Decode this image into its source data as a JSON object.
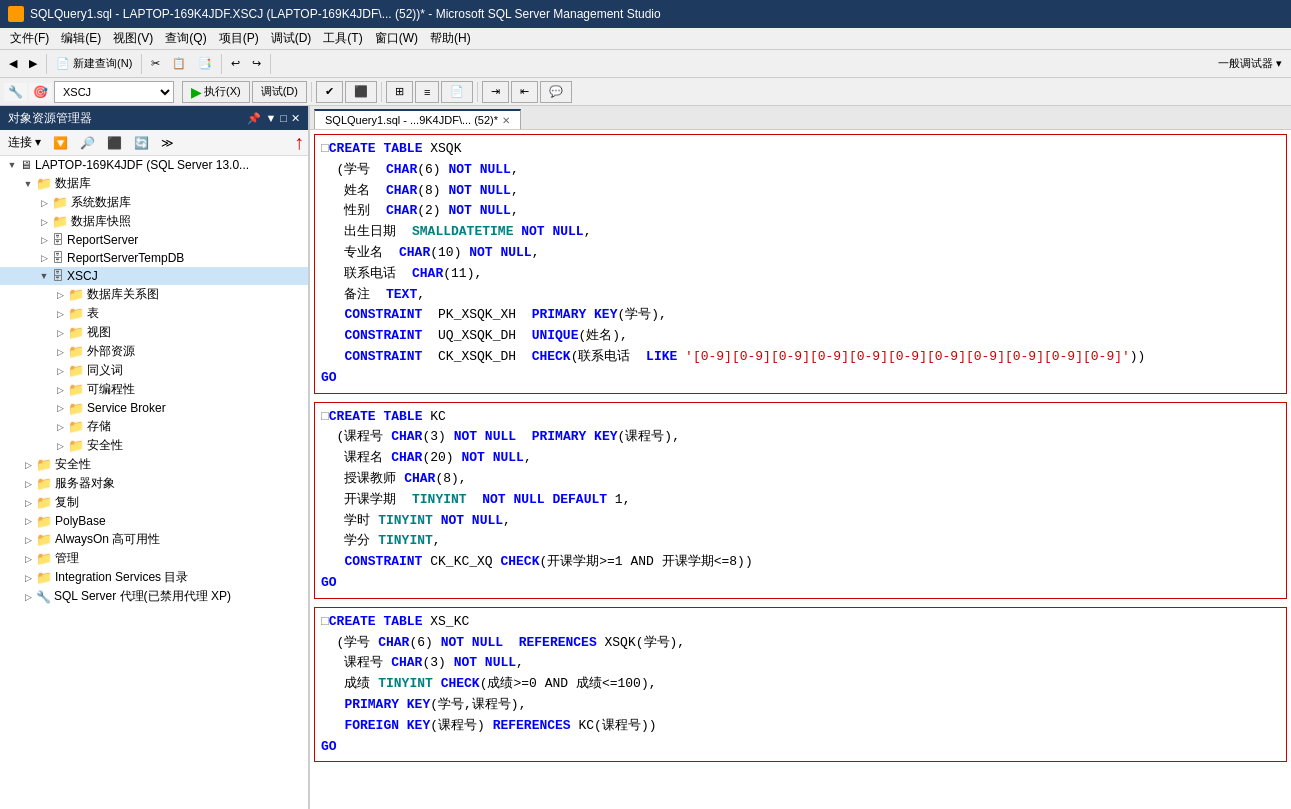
{
  "titleBar": {
    "title": "SQLQuery1.sql - LAPTOP-169K4JDF.XSCJ (LAPTOP-169K4JDF\\... (52))* - Microsoft SQL Server Management Studio"
  },
  "menuBar": {
    "items": [
      "文件(F)",
      "编辑(E)",
      "视图(V)",
      "查询(Q)",
      "项目(P)",
      "调试(D)",
      "工具(T)",
      "窗口(W)",
      "帮助(H)"
    ]
  },
  "toolbar2": {
    "dbSelector": "XSCJ",
    "executeBtn": "执行(X)",
    "debugBtn": "调试(D)"
  },
  "objectExplorer": {
    "title": "对象资源管理器",
    "connectBtn": "连接",
    "server": "LAPTOP-169K4JDF (SQL Server 13.0...",
    "nodes": [
      {
        "label": "数据库",
        "level": 1,
        "expanded": true
      },
      {
        "label": "系统数据库",
        "level": 2,
        "expanded": false
      },
      {
        "label": "数据库快照",
        "level": 2,
        "expanded": false
      },
      {
        "label": "ReportServer",
        "level": 2,
        "expanded": false
      },
      {
        "label": "ReportServerTempDB",
        "level": 2,
        "expanded": false
      },
      {
        "label": "XSCJ",
        "level": 2,
        "expanded": true
      },
      {
        "label": "数据库关系图",
        "level": 3,
        "expanded": false
      },
      {
        "label": "表",
        "level": 3,
        "expanded": false
      },
      {
        "label": "视图",
        "level": 3,
        "expanded": false
      },
      {
        "label": "外部资源",
        "level": 3,
        "expanded": false
      },
      {
        "label": "同义词",
        "level": 3,
        "expanded": false
      },
      {
        "label": "可编程性",
        "level": 3,
        "expanded": false
      },
      {
        "label": "Service Broker",
        "level": 3,
        "expanded": false
      },
      {
        "label": "存储",
        "level": 3,
        "expanded": false
      },
      {
        "label": "安全性",
        "level": 3,
        "expanded": false
      },
      {
        "label": "安全性",
        "level": 1,
        "expanded": false
      },
      {
        "label": "服务器对象",
        "level": 1,
        "expanded": false
      },
      {
        "label": "复制",
        "level": 1,
        "expanded": false
      },
      {
        "label": "PolyBase",
        "level": 1,
        "expanded": false
      },
      {
        "label": "AlwaysOn 高可用性",
        "level": 1,
        "expanded": false
      },
      {
        "label": "管理",
        "level": 1,
        "expanded": false
      },
      {
        "label": "Integration Services 目录",
        "level": 1,
        "expanded": false
      },
      {
        "label": "SQL Server 代理(已禁用代理 XP)",
        "level": 1,
        "expanded": false
      }
    ]
  },
  "tabs": [
    {
      "label": "SQLQuery1.sql - ...9K4JDF\\... (52)*",
      "active": true
    },
    {
      "label": "×",
      "active": false
    }
  ],
  "codeBlocks": [
    {
      "id": "block1",
      "lines": [
        "□CREATE TABLE XSQK",
        "  (学号  CHAR(6) NOT NULL,",
        "   姓名  CHAR(8) NOT NULL,",
        "   性别  CHAR(2) NOT NULL,",
        "   出生日期  SMALLDATETIME NOT NULL,",
        "   专业名  CHAR(10) NOT NULL,",
        "   联系电话  CHAR(11),",
        "   备注  TEXT,",
        "   CONSTRAINT  PK_XSQK_XH  PRIMARY KEY(学号),",
        "   CONSTRAINT  UQ_XSQK_DH  UNIQUE(姓名),",
        "   CONSTRAINT  CK_XSQK_DH  CHECK(联系电话  LIKE '[0-9][0-9][0-9][0-9][0-9][0-9][0-9][0-9][0-9][0-9][0-9]'))",
        "GO"
      ]
    },
    {
      "id": "block2",
      "lines": [
        "□CREATE TABLE KC",
        "  (课程号 CHAR(3) NOT NULL PRIMARY KEY(课程号),",
        "   课程名 CHAR(20) NOT NULL,",
        "   授课教师 CHAR(8),",
        "   开课学期  TINYINT  NOT NULL DEFAULT 1,",
        "   学时 TINYINT NOT NULL,",
        "   学分 TINYINT,",
        "   CONSTRAINT CK_KC_XQ CHECK(开课学期>=1 AND 开课学期<=8))",
        "GO"
      ]
    },
    {
      "id": "block3",
      "lines": [
        "□CREATE TABLE XS_KC",
        "  (学号 CHAR(6) NOT NULL  REFERENCES XSQK(学号),",
        "   课程号 CHAR(3) NOT NULL,",
        "   成绩 TINYINT CHECK(成绩>=0 AND 成绩<=100),",
        "   PRIMARY KEY(学号,课程号),",
        "   FOREIGN KEY(课程号) REFERENCES KC(课程号))",
        "GO"
      ]
    }
  ]
}
